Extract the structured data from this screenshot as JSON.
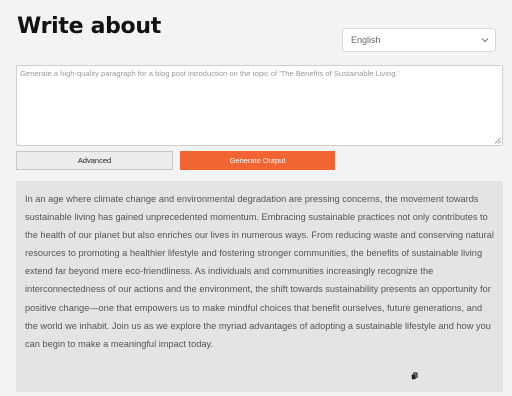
{
  "header": {
    "title": "Write about"
  },
  "language": {
    "selected": "English"
  },
  "prompt": {
    "placeholder": "Generate a high-quality paragraph for a blog post introduction on the topic of 'The Benefits of Sustainable Living.'"
  },
  "actions": {
    "advanced_label": "Advanced",
    "generate_label": "Generate Output"
  },
  "output": {
    "text": "In an age where climate change and environmental degradation are pressing concerns, the movement towards sustainable living has gained unprecedented momentum. Embracing sustainable practices not only contributes to the health of our planet but also enriches our lives in numerous ways. From reducing waste and conserving natural resources to promoting a healthier lifestyle and fostering stronger communities, the benefits of sustainable living extend far beyond mere eco-friendliness. As individuals and communities increasingly recognize the interconnectedness of our actions and the environment, the shift towards sustainability presents an opportunity for positive change—one that empowers us to make mindful choices that benefit ourselves, future generations, and the world we inhabit. Join us as we explore the myriad advantages of adopting a sustainable lifestyle and how you can begin to make a meaningful impact today."
  },
  "icons": {
    "dropdown": "chevron-down-icon",
    "copy": "copy-icon",
    "resize": "resize-grip-icon"
  },
  "colors": {
    "accent": "#f26532",
    "output_bg": "#e4e4e4",
    "page_bg": "#f3f3f3"
  }
}
